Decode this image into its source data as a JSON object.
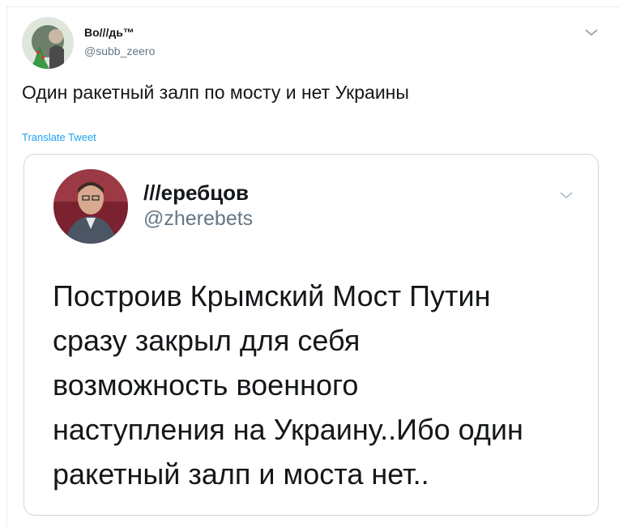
{
  "tweet": {
    "author_name": "Во///дь™",
    "author_handle": "@subb_zeero",
    "text": "Один ракетный залп по мосту и нет Украины",
    "translate_label": "Translate Tweet",
    "menu_icon": "chevron-down-icon"
  },
  "quoted_tweet": {
    "author_name": "///еребцов",
    "author_handle": "@zherebets",
    "lines": [
      "Построив Крымский Мост Путин",
      "сразу закрыл для себя",
      "возможность военного",
      "наступления на Украину..Ибо один",
      "ракетный залп и моста нет.."
    ],
    "menu_icon": "chevron-down-icon"
  },
  "colors": {
    "text": "#14171a",
    "secondary": "#657786",
    "link": "#1da1f2",
    "border": "#ccd6dd"
  }
}
